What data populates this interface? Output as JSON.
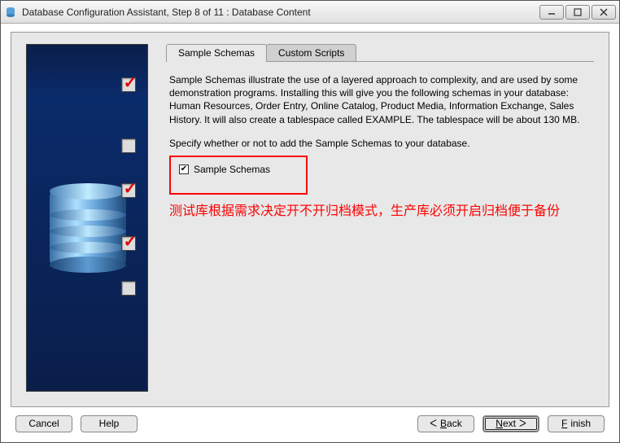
{
  "window": {
    "title": "Database Configuration Assistant, Step 8 of 11 : Database Content"
  },
  "sidebar": {
    "steps": [
      {
        "checked": true
      },
      {
        "checked": false
      },
      {
        "checked": true
      },
      {
        "checked": true
      },
      {
        "checked": false
      }
    ]
  },
  "tabs": {
    "sample": "Sample Schemas",
    "custom": "Custom Scripts"
  },
  "content": {
    "description": "Sample Schemas illustrate the use of a layered approach to complexity, and are used by some demonstration programs. Installing this will give you the following schemas in your database: Human Resources, Order Entry, Online Catalog, Product Media, Information Exchange, Sales History. It will also create a tablespace called EXAMPLE. The tablespace will be about 130 MB.",
    "specify": "Specify whether or not to add the Sample Schemas to your database.",
    "checkbox_label": "Sample Schemas",
    "checkbox_checked": true,
    "note": "测试库根据需求决定开不开归档模式，生产库必须开启归档便于备份"
  },
  "buttons": {
    "cancel": "Cancel",
    "help": "Help",
    "back": "Back",
    "next": "Next",
    "finish": "Finish"
  }
}
